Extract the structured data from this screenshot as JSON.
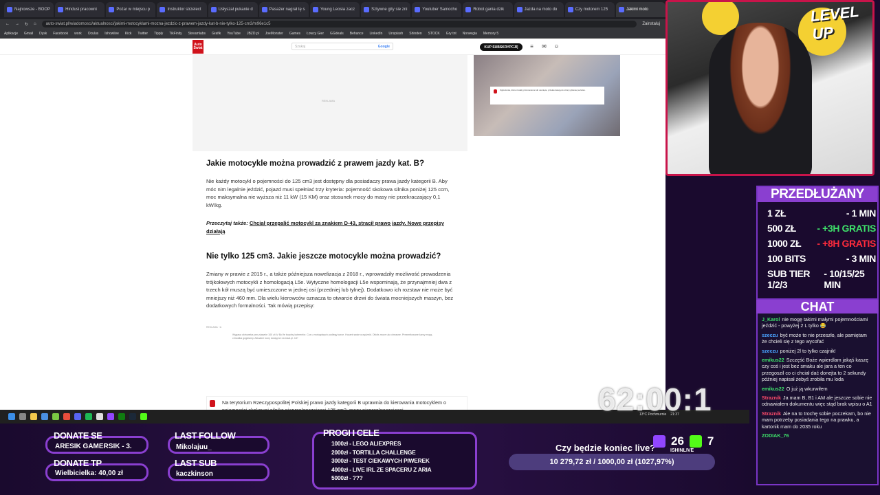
{
  "browser": {
    "tabs": [
      "Najnowsze - BOOP",
      "Hindusi pracowni",
      "Pożar w miejscu p",
      "Instruktor strzelect",
      "Usłyszał pukanie d",
      "Pasażer nagrał tę s",
      "Young Leosia zacz",
      "Sztywne gity sie zni",
      "Youtuber Samocho",
      "Robot gania dzik",
      "Jazda na moto do",
      "Czy motorem 125",
      "Jakimi moto"
    ],
    "url": "auto-swiat.pl/wiadomosci/aktualnosci/jakimi-motocyklami-mozna-jezdzic-z-prawem-jazdy-kat-b-nie-tylko-125-cm3/m96e1c5",
    "profile_label": "Zainstaluj",
    "bookmarks": [
      "Aplikacje",
      "Gmail",
      "Dysk",
      "Facebook",
      "work",
      "Oculus",
      "Ishowlive",
      "Kick",
      "Twitter",
      "Tipply",
      "TikFinity",
      "Streamlabs",
      "Grafik",
      "YouTube",
      "JBZD.pl",
      "JoeMonster",
      "Games",
      "Łowcy Gier",
      "GGdeals",
      "Behance",
      "LinkedIn",
      "Unsplash",
      "Shinden",
      "STOCK",
      "Gry tnt",
      "Norwegia",
      "Memory 5"
    ]
  },
  "site": {
    "logo_text": "Auto Świat",
    "search_placeholder": "Szukaj",
    "search_brand": "Google",
    "subscribe_label": "KUP SUBSKRYPCJĘ",
    "ad_label": "REKLAMA",
    "video_note": "Ogłoszenia, które zostały przeniesione lub usunięte, przekierowują do strony głównej serwisu."
  },
  "article": {
    "h1": "Jakie motocykle można prowadzić z prawem jazdy kat. B?",
    "p1": "Nie każdy motocykl o pojemności do 125 cm3 jest dostępny dla posiadaczy prawa jazdy kategorii B. Aby móc nim legalnie jeździć, pojazd musi spełniać trzy kryteria: pojemność skokowa silnika poniżej 125 ccm, moc maksymalna nie wyższa niż 11 kW (15 KM) oraz stosunek mocy do masy nie przekraczający 0,1 kW/kg.",
    "read_label": "Przeczytaj także:",
    "read_link": "Chciał przepalić motocykl za znakiem D-43, stracił prawo jazdy. Nowe przepisy działają",
    "h2": "Nie tylko 125 cm3. Jakie jeszcze motocykle można prowadzić?",
    "p2": "Zmiany w prawie z 2015 r., a także późniejsza nowelizacja z 2018 r., wprowadziły możliwość prowadzenia trójkołowych motocykli z homologacją L5e. Wytyczne homologacji L5e wspominają, że przynajmniej dwa z trzech kół muszą być umieszczone w jednej osi (przedniej lub tylnej). Dodatkowo ich rozstaw nie może być mniejszy niż 460 mm. Dla wielu kierowców oznacza to otwarcie drzwi do świata mocniejszych maszyn, bez dodatkowych formalności. Tak mówią przepisy:",
    "ad_small": "REKLAMA · in",
    "ad_caption": "Wygasa oktroweka przy sławnie 100 zł kV Bcl fe boydny kotmenfor. Cza u motogdwych podłegy karce. Hozant saste urządzeid. Oficits moze uko cheasne. Prezenttowane karcy mogą chrwalka gogdiamy. Aktualne kuny dostępne na lokal.pl. 18+",
    "law_text": "Na terytorium Rzeczypospolitej Polskiej prawo jazdy kategorii B uprawnia do kierowania motocyklem o pojemności skokowej silnika nieprzekraczającej 125 cm3, mocy nieprzekraczającej"
  },
  "taskbar": {
    "weather": "13°C Pochmurnie",
    "time": "21:37"
  },
  "overlay": {
    "timer": "62:00:1",
    "level_up": "LEVEL UP",
    "price_title": "PRZEDŁUŻANY",
    "price_rows": [
      {
        "k": "1 ZŁ",
        "v": "- 1 MIN",
        "c": ""
      },
      {
        "k": "500 ZŁ",
        "v": "- +3H GRATIS",
        "c": "g"
      },
      {
        "k": "1000 ZŁ",
        "v": "- +8H GRATIS",
        "c": "r"
      },
      {
        "k": "100 BITS",
        "v": "- 3 MIN",
        "c": ""
      },
      {
        "k": "SUB TIER 1/2/3",
        "v": "- 10/15/25 MIN",
        "c": ""
      }
    ],
    "chat_title": "CHAT",
    "chat": [
      {
        "user": "J_Karol",
        "color": "#3ee06a",
        "text": "nie mogę takimi małymi pojemnościami jeździć - powyżej 2 L tylko 😂"
      },
      {
        "user": "szeczu",
        "color": "#4aa3ff",
        "text": "być może to nie przeszło, ale pamiętam że chcieli się z tego wycofać"
      },
      {
        "user": "szeczu",
        "color": "#4aa3ff",
        "text": "poniżej 2l to tylko czajnik!"
      },
      {
        "user": "emikus22",
        "color": "#3ee06a",
        "text": "Szczęść Boże wpierdlam jakąś kaszę czy coś i jest bez smaku ale jara a ten co przegoszil co ci chciał dać donejta to 2 sekundy później napisał żebyś zrobiła mu loda"
      },
      {
        "user": "emikus22",
        "color": "#3ee06a",
        "text": "O już ją wkurwiłem"
      },
      {
        "user": "Straznik",
        "color": "#ff4b6b",
        "text": "Ja mam B, B1 i AM ale jeszcze sobie nie odnawiałem dokumentu więc stąd brak wpisu o A1"
      },
      {
        "user": "Straznik",
        "color": "#ff4b6b",
        "text": "Ale na to trochę sobie poczekam, bo nie mam potrzeby posiadania tego na prawku, a kartonik mam do 2035 roku"
      },
      {
        "user": "ZODIAK_76",
        "color": "#3ee06a",
        "text": ""
      }
    ],
    "donate_se_label": "DONATE SE",
    "donate_se_value": "ARESIK GAMERSIK - 3.",
    "donate_tp_label": "DONATE TP",
    "donate_tp_value": "Wielbicielka: 40,00 zł",
    "last_follow_label": "LAST FOLLOW",
    "last_follow_value": "Mikolajuu_",
    "last_sub_label": "LAST SUB",
    "last_sub_value": "kaczkinson",
    "goals_title": "PROGI I CELE",
    "goals": [
      "1000zł - LEGO ALIEXPRES",
      "2000zł - TORTILLA CHALLENGE",
      "3000zł - TEST CIEKAWYCH PIWEREK",
      "4000zł - LIVE IRL ZE SPACERU Z ARIA",
      "5000zł - ???"
    ],
    "poll_question": "Czy będzie koniec live?",
    "fund": "10 279,72 zł / 1000,00 zł (1027,97%)",
    "subs": "26",
    "kicks": "7",
    "channel": "ISHINLIVE"
  },
  "colors": {
    "accent": "#8a3fd0",
    "brand_red": "#d0121b",
    "green": "#3ee06a",
    "red": "#ff2b3c"
  }
}
